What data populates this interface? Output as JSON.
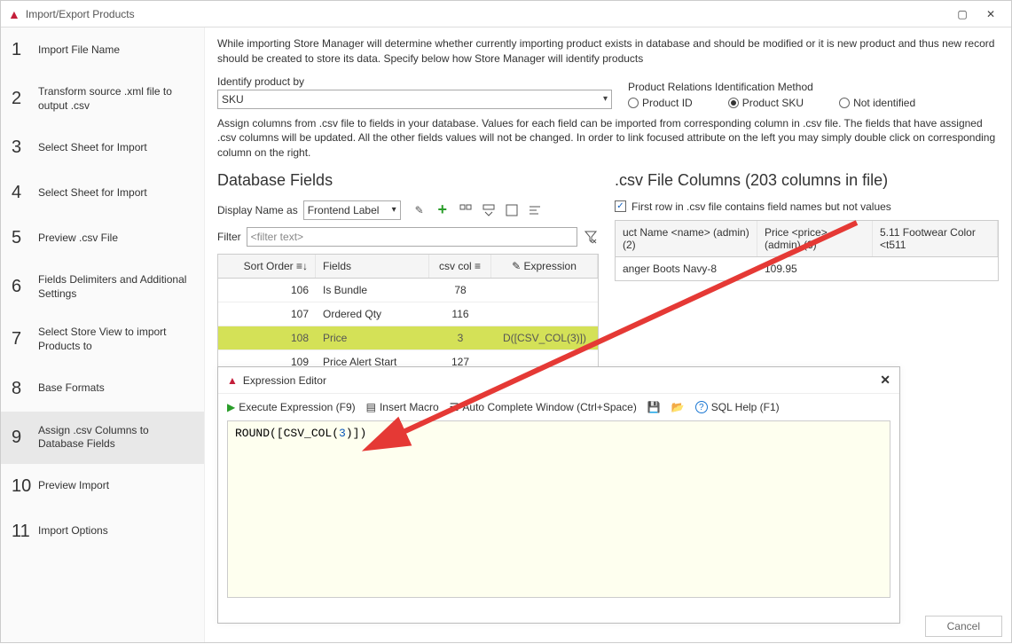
{
  "window": {
    "title": "Import/Export Products"
  },
  "steps": [
    {
      "num": "1",
      "label": "Import File Name"
    },
    {
      "num": "2",
      "label": "Transform source .xml file to output .csv"
    },
    {
      "num": "3",
      "label": "Select Sheet for Import"
    },
    {
      "num": "4",
      "label": "Select Sheet for Import"
    },
    {
      "num": "5",
      "label": "Preview .csv File"
    },
    {
      "num": "6",
      "label": "Fields Delimiters and Additional Settings"
    },
    {
      "num": "7",
      "label": "Select Store View to import Products to"
    },
    {
      "num": "8",
      "label": "Base Formats"
    },
    {
      "num": "9",
      "label": "Assign .csv Columns to Database Fields"
    },
    {
      "num": "10",
      "label": "Preview Import"
    },
    {
      "num": "11",
      "label": "Import Options"
    }
  ],
  "intro": "While importing Store Manager will determine whether currently importing product exists in database and should be modified or it is new product and thus new record should be created to store its data. Specify below how Store Manager will identify products",
  "identify": {
    "label": "Identify product by",
    "value": "SKU",
    "methodLabel": "Product Relations Identification Method",
    "radios": {
      "id": "Product ID",
      "sku": "Product SKU",
      "not": "Not identified"
    }
  },
  "assignText": "Assign columns from .csv file to fields in your database. Values for each field can be imported from corresponding column in .csv file. The fields that have assigned .csv columns will be updated. All the other fields values will not be changed. In order to link focused attribute on the left you may simply double click on corresponding column on the right.",
  "leftSection": {
    "title": "Database Fields",
    "displayLabel": "Display Name as",
    "displayValue": "Frontend Label",
    "filterLabel": "Filter",
    "filterPlaceholder": "<filter text>",
    "headers": {
      "sort": "Sort Order",
      "fields": "Fields",
      "csv": "csv col",
      "expr": "Expression"
    },
    "rows": [
      {
        "sort": "106",
        "field": "Is Bundle",
        "csv": "78",
        "expr": ""
      },
      {
        "sort": "107",
        "field": "Ordered Qty",
        "csv": "116",
        "expr": ""
      },
      {
        "sort": "108",
        "field": "Price",
        "csv": "3",
        "expr": "D([CSV_COL(3)])"
      },
      {
        "sort": "109",
        "field": "Price Alert Start Date",
        "csv": "127",
        "expr": ""
      }
    ]
  },
  "rightSection": {
    "title": ".csv File Columns (203 columns in file)",
    "checkboxLabel": "First row in .csv file contains field names but not values",
    "headers": {
      "c1": "uct Name <name> (admin) (2)",
      "c2": "Price <price> (admin) (3)",
      "c3": "5.11 Footwear Color <t511"
    },
    "row": {
      "c1": "anger Boots Navy-8",
      "c2": "109.95",
      "c3": ""
    }
  },
  "editor": {
    "title": "Expression Editor",
    "toolbar": {
      "execute": "Execute Expression (F9)",
      "macro": "Insert Macro",
      "auto": "Auto Complete Window (Ctrl+Space)",
      "sql": "SQL Help (F1)"
    },
    "expression": {
      "p1": "ROUND",
      "p2": "([",
      "p3": "CSV_COL",
      "p4": "(",
      "p5": "3",
      "p6": ")])"
    }
  },
  "buttons": {
    "cancel": "Cancel"
  }
}
